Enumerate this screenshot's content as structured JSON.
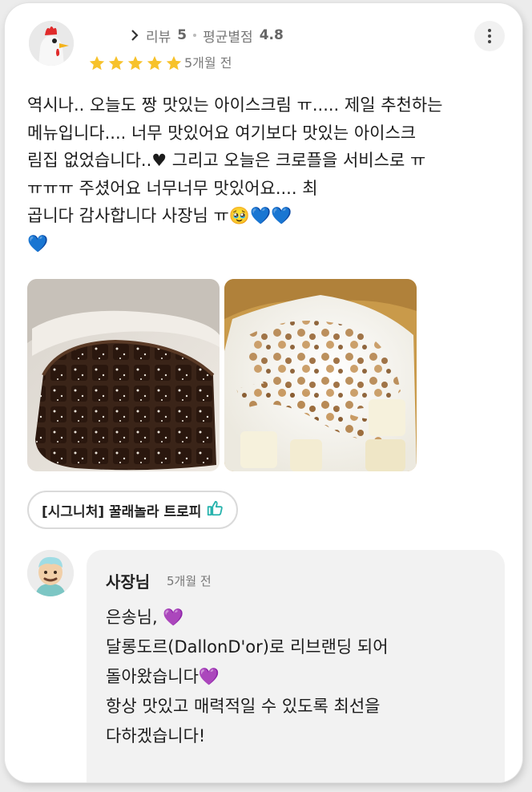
{
  "header": {
    "reviews_label": "리뷰",
    "reviews_count": "5",
    "avg_label": "평균별점",
    "avg_value": "4.8",
    "rating": 5,
    "date": "5개월 전"
  },
  "review": {
    "text": "역시나.. 오늘도 짱 맛있는 아이스크림 ㅠ..... 제일 추천하는\n 메뉴입니다.... 너무 맛있어요 여기보다 맛있는 아이스크\n림집 없었습니다..♥ 그리고 오늘은 크로플을 서비스로 ㅠ\nㅠㅠㅠ 주셨어요 너무너무 맛있어요.... 최\n곱니다 감사합니다 사장님 ㅠ🥹💙💙\n💙"
  },
  "tag": {
    "label": "[시그니처] 꿀래놀라 트로피"
  },
  "reply": {
    "name": "사장님",
    "date": "5개월 전",
    "text": "은송님, 💜\n달롱도르(DallonD'or)로 리브랜딩 되어\n돌아왔습니다💜\n항상 맛있고 매력적일 수 있도록 최선을\n다하겠습니다!"
  },
  "colors": {
    "star": "#f7c22b",
    "heart_red": "#e3293a",
    "heart_blue": "#7fd3f2",
    "heart_purple": "#a33fe0",
    "thumb": "#27b3ad"
  }
}
